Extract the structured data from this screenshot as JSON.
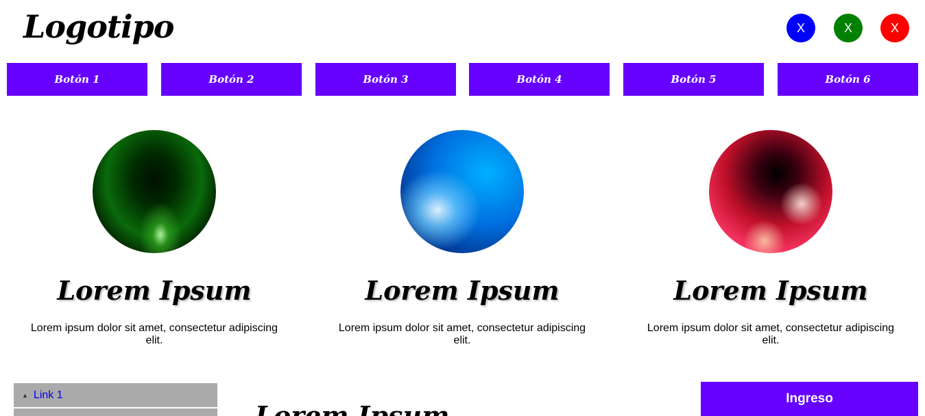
{
  "header": {
    "logo": "Logotipo",
    "window_buttons": [
      {
        "label": "X",
        "color": "#0000ff"
      },
      {
        "label": "X",
        "color": "#008000"
      },
      {
        "label": "X",
        "color": "#ff0000"
      }
    ]
  },
  "nav": {
    "buttons": [
      "Botón 1",
      "Botón 2",
      "Botón 3",
      "Botón 4",
      "Botón 5",
      "Botón 6"
    ],
    "color": "#6600ff"
  },
  "cards": [
    {
      "title": "Lorem Ipsum",
      "text": "Lorem ipsum dolor sit amet, consectetur adipiscing elit."
    },
    {
      "title": "Lorem Ipsum",
      "text": "Lorem ipsum dolor sit amet, consectetur adipiscing elit."
    },
    {
      "title": "Lorem Ipsum",
      "text": "Lorem ipsum dolor sit amet, consectetur adipiscing elit."
    }
  ],
  "sidebar": {
    "links": [
      {
        "label": "Link 1"
      }
    ]
  },
  "main": {
    "title": "Lorem Ipsum"
  },
  "login": {
    "label": "Ingreso"
  }
}
